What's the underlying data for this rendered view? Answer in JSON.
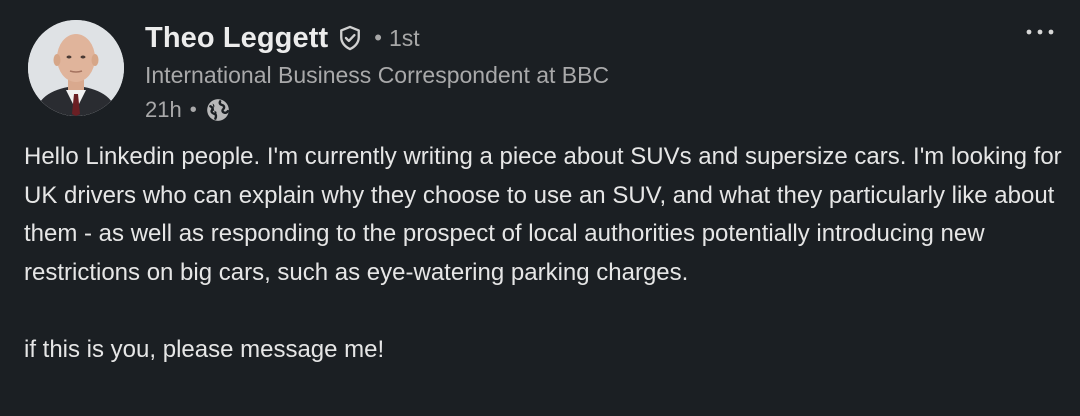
{
  "author": {
    "name": "Theo Leggett",
    "connection_degree": "1st",
    "headline": "International Business Correspondent at BBC",
    "verified_icon": "shield-check-icon",
    "avatar": "profile-photo"
  },
  "meta": {
    "time_ago": "21h",
    "separator": "•",
    "visibility_icon": "globe-icon"
  },
  "header_separator": "•",
  "more_menu_icon": "more-horizontal-icon",
  "post": {
    "paragraph_1": "Hello Linkedin people. I'm currently writing a piece about SUVs and supersize cars. I'm looking for UK drivers who can explain why they choose to use an SUV, and what they particularly like about them - as well as responding to the prospect of local authorities potentially introducing new restrictions on big cars, such as eye-watering parking charges.",
    "paragraph_2": "if this is you, please message me!"
  },
  "colors": {
    "background": "#1b1f23",
    "primary_text": "#e9e9ea",
    "secondary_text": "#a9a9aa"
  }
}
